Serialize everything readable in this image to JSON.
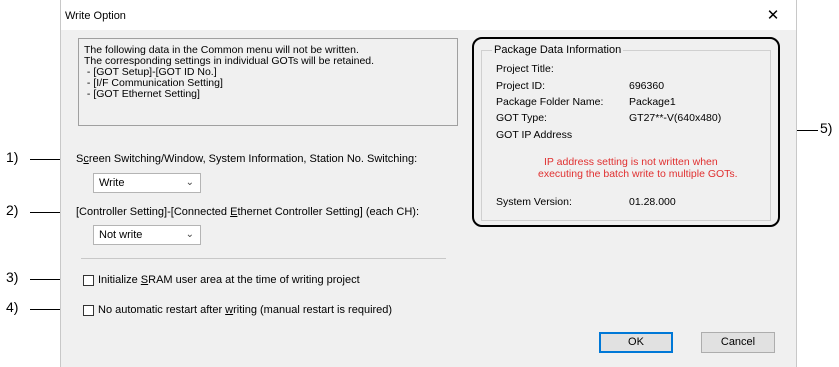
{
  "window": {
    "title": "Write Option",
    "close_glyph": "✕"
  },
  "notice": {
    "lines": [
      "The following data in the Common menu will not be written.",
      "The corresponding settings in individual GOTs will be retained.",
      " - [GOT Setup]-[GOT ID No.]",
      " - [I/F Communication Setting]",
      " - [GOT Ethernet Setting]"
    ]
  },
  "screen_switch": {
    "label_pre": "S",
    "label_u": "c",
    "label_post": "reen Switching/Window, System Information, Station No. Switching:",
    "value": "Write"
  },
  "controller": {
    "label_pre": "[Controller Setting]-[Connected ",
    "label_u": "E",
    "label_post": "thernet Controller Setting] (each CH):",
    "value": "Not write"
  },
  "init_sram": {
    "label_pre": "Initialize ",
    "label_u": "S",
    "label_post": "RAM user area at the time of writing project",
    "checked": false
  },
  "no_restart": {
    "label_pre": "No automatic restart after ",
    "label_u": "w",
    "label_post": "riting (manual restart is required)",
    "checked": false
  },
  "package": {
    "title": "Package Data Information",
    "project_title_label": "Project Title:",
    "project_id_label": "Project ID:",
    "project_id_value": "696360",
    "folder_label": "Package Folder Name:",
    "folder_value": "Package1",
    "got_type_label": "GOT Type:",
    "got_type_value": "GT27**-V(640x480)",
    "ip_label": "GOT IP Address",
    "warning_1": "IP address setting is not written when",
    "warning_2": "executing the batch write to multiple GOTs.",
    "version_label": "System Version:",
    "version_value": "01.28.000"
  },
  "buttons": {
    "ok": "OK",
    "cancel": "Cancel"
  },
  "callouts": {
    "c1": "1)",
    "c2": "2)",
    "c3": "3)",
    "c4": "4)",
    "c5": "5)"
  },
  "icons": {
    "dropdown": "chevron-down-icon",
    "close": "close-icon"
  }
}
